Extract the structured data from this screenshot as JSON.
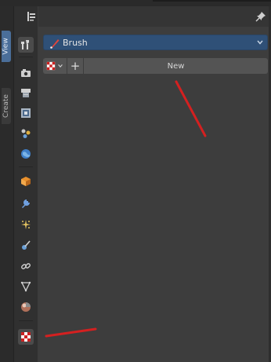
{
  "left_tabs": [
    {
      "label": "View",
      "state": "active"
    },
    {
      "label": "Create",
      "state": "inactive"
    }
  ],
  "sidebar": {
    "icons": [
      {
        "name": "tool-icon",
        "kind": "tool",
        "active": true
      },
      {
        "name": "render-icon",
        "kind": "render"
      },
      {
        "name": "output-icon",
        "kind": "output"
      },
      {
        "name": "view-layer-icon",
        "kind": "viewlayer"
      },
      {
        "name": "scene-icon",
        "kind": "scene"
      },
      {
        "name": "world-icon",
        "kind": "world"
      },
      {
        "name": "object-icon",
        "kind": "object"
      },
      {
        "name": "modifier-icon",
        "kind": "modifier"
      },
      {
        "name": "particles-icon",
        "kind": "particles"
      },
      {
        "name": "physics-icon",
        "kind": "physics"
      },
      {
        "name": "constraints-icon",
        "kind": "constraints"
      },
      {
        "name": "object-data-icon",
        "kind": "data"
      },
      {
        "name": "material-icon",
        "kind": "material"
      },
      {
        "name": "texture-icon",
        "kind": "texture",
        "active": true
      }
    ]
  },
  "brush": {
    "label": "Brush"
  },
  "texture": {
    "new_label": "New",
    "add_symbol": "+"
  },
  "colors": {
    "accent": "#2f5077",
    "annotation": "#d42020"
  }
}
